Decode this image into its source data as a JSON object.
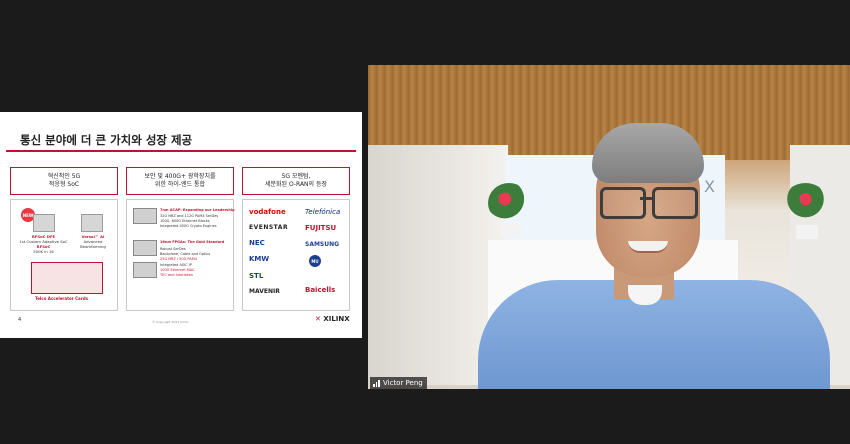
{
  "slide": {
    "title": "통신 분야에 더 큰 가치와 성장 제공",
    "page_number": "4",
    "copyright": "© Copyright 2021 Xilinx",
    "brand": "XILINX",
    "columns": [
      {
        "heading_lines": [
          "혁신적인 5G",
          "적응형 SoC"
        ],
        "new_badge": "NEW",
        "product1_lines": [
          "RFSoC DFE",
          "1st Custom Adaptive SoC",
          "RFSoC",
          "500K in 16"
        ],
        "product2_lines": [
          "Versal™ AI",
          "Advanced",
          "Beamforming"
        ],
        "card_label": "Telco Accelerator Cards"
      },
      {
        "heading_lines": [
          "보안 및 400G+ 광학장치를",
          "위한 하이-엔드 통합"
        ],
        "group1_title": "7nm ACAP: Expanding our Leadership",
        "group1_items": [
          "32G NRZ and 112G PAM4 SerDes",
          "100G, 600G Ethernet Blocks",
          "Integrated 400G Crypto Engines"
        ],
        "group2_title": "16nm FPGAs: The Gold Standard",
        "group2_items": [
          "Robust SerDes",
          "Backplane, Cable and Optics",
          "25G NRZ / 50G PAM4",
          "Integrated ASIC IP",
          "100G Ethernet MAC",
          "TEC and Interlaken"
        ]
      },
      {
        "heading_lines": [
          "5G 모멘텀,",
          "세분화된 O-RAN의 등장"
        ],
        "logos": [
          "vodafone",
          "Telefónica",
          "EVENSTAR",
          "FUJITSU",
          "NEC",
          "SAMSUNG",
          "KMW",
          "MU",
          "STL",
          "MAVENIR",
          "Baicells"
        ]
      }
    ]
  },
  "video": {
    "participant_name": "Victor Peng",
    "wall_logo": "X"
  },
  "colors": {
    "accent": "#c3122f",
    "window_bg": "#1b1b1b",
    "shirt": "#7ea3d8"
  }
}
